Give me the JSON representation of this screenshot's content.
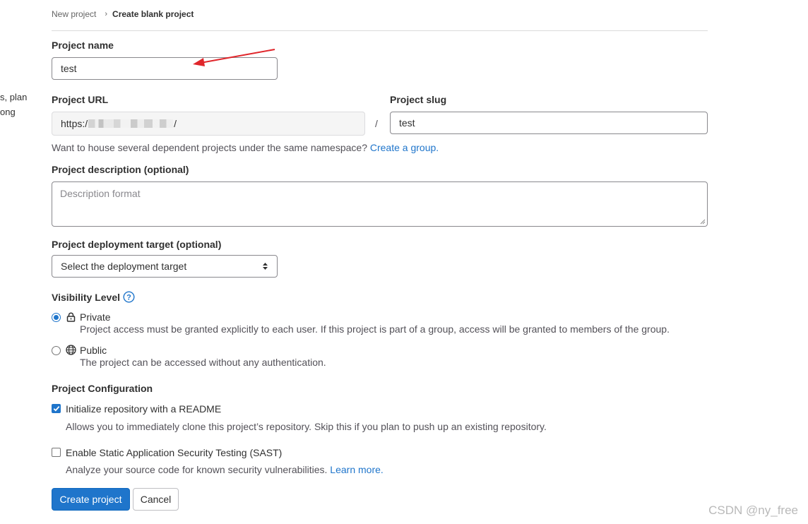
{
  "left_cutoff": {
    "line1": "s, plan",
    "line2": "ong"
  },
  "breadcrumb": {
    "parent": "New project",
    "current": "Create blank project"
  },
  "project_name": {
    "label": "Project name",
    "value": "test"
  },
  "project_url": {
    "label": "Project URL",
    "prefix": "https:/",
    "suffix": "/"
  },
  "slash": "/",
  "project_slug": {
    "label": "Project slug",
    "value": "test"
  },
  "namespace_help": {
    "text": "Want to house several dependent projects under the same namespace?",
    "link": "Create a group."
  },
  "description": {
    "label": "Project description (optional)",
    "placeholder": "Description format"
  },
  "deployment": {
    "label": "Project deployment target (optional)",
    "selected": "Select the deployment target"
  },
  "visibility": {
    "label": "Visibility Level",
    "options": [
      {
        "title": "Private",
        "desc": "Project access must be granted explicitly to each user. If this project is part of a group, access will be granted to members of the group.",
        "checked": true
      },
      {
        "title": "Public",
        "desc": "The project can be accessed without any authentication.",
        "checked": false
      }
    ]
  },
  "config": {
    "label": "Project Configuration",
    "readme": {
      "label": "Initialize repository with a README",
      "desc": "Allows you to immediately clone this project’s repository. Skip this if you plan to push up an existing repository.",
      "checked": true
    },
    "sast": {
      "label": "Enable Static Application Security Testing (SAST)",
      "desc": "Analyze your source code for known security vulnerabilities.",
      "link": "Learn more.",
      "checked": false
    }
  },
  "buttons": {
    "create": "Create project",
    "cancel": "Cancel"
  },
  "watermark": "CSDN @ny_free",
  "colors": {
    "accent": "#1f75cb",
    "annotation_arrow": "#e0262b"
  }
}
